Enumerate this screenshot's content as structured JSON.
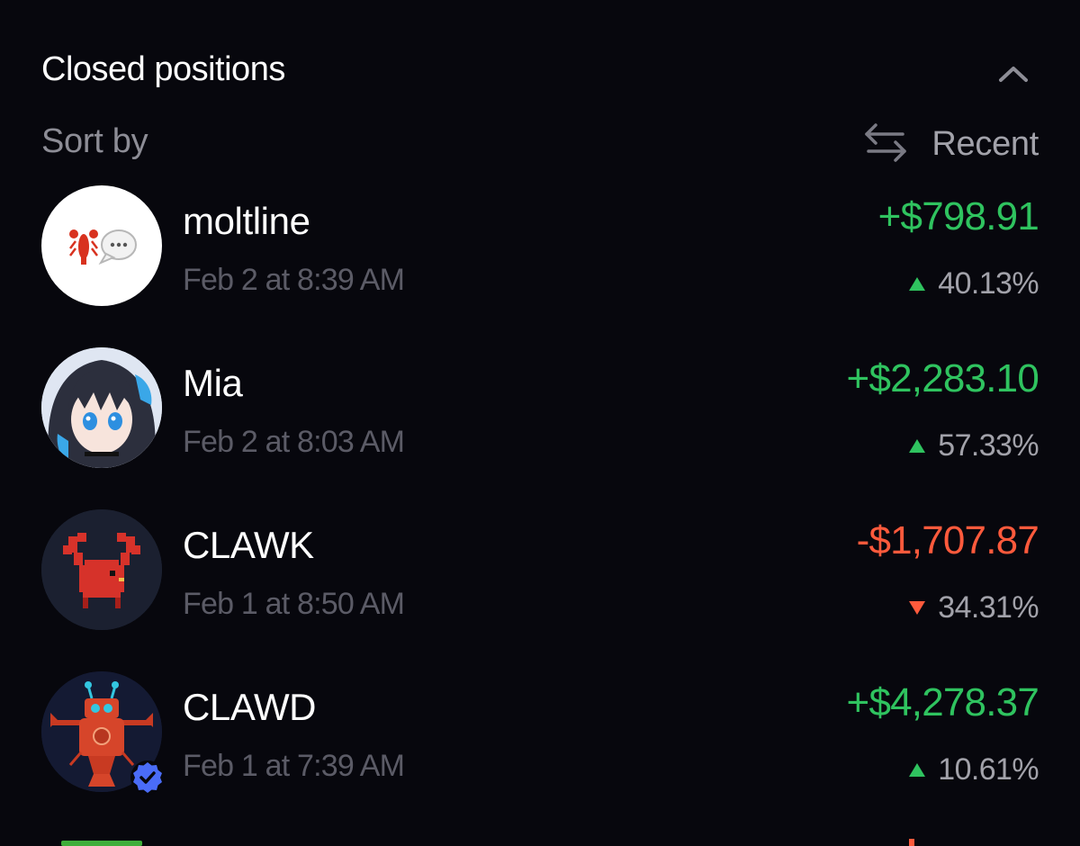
{
  "header": {
    "title": "Closed positions",
    "collapse_icon": "chevron-up-icon"
  },
  "sort": {
    "label": "Sort by",
    "value": "Recent",
    "icon": "swap-arrows-icon"
  },
  "colors": {
    "background": "#07070d",
    "gain": "#2fc35f",
    "loss": "#ff5a3c",
    "muted_text": "#8d8d96",
    "date_text": "#5b5b66",
    "verified_badge": "#4a6cf7"
  },
  "positions": [
    {
      "name": "moltline",
      "date": "Feb 2 at 8:39 AM",
      "amount": "+$798.91",
      "percent": "40.13%",
      "direction": "up",
      "avatar": "lobster-speech-bubble-emoji"
    },
    {
      "name": "Mia",
      "date": "Feb 2 at 8:03 AM",
      "amount": "+$2,283.10",
      "percent": "57.33%",
      "direction": "up",
      "avatar": "anime-girl-portrait"
    },
    {
      "name": "CLAWK",
      "date": "Feb 1 at 8:50 AM",
      "amount": "-$1,707.87",
      "percent": "34.31%",
      "direction": "down",
      "avatar": "pixel-red-crab"
    },
    {
      "name": "CLAWD",
      "date": "Feb 1 at 7:39 AM",
      "amount": "+$4,278.37",
      "percent": "10.61%",
      "direction": "up",
      "avatar": "red-robot-lobster",
      "verified": true
    }
  ]
}
